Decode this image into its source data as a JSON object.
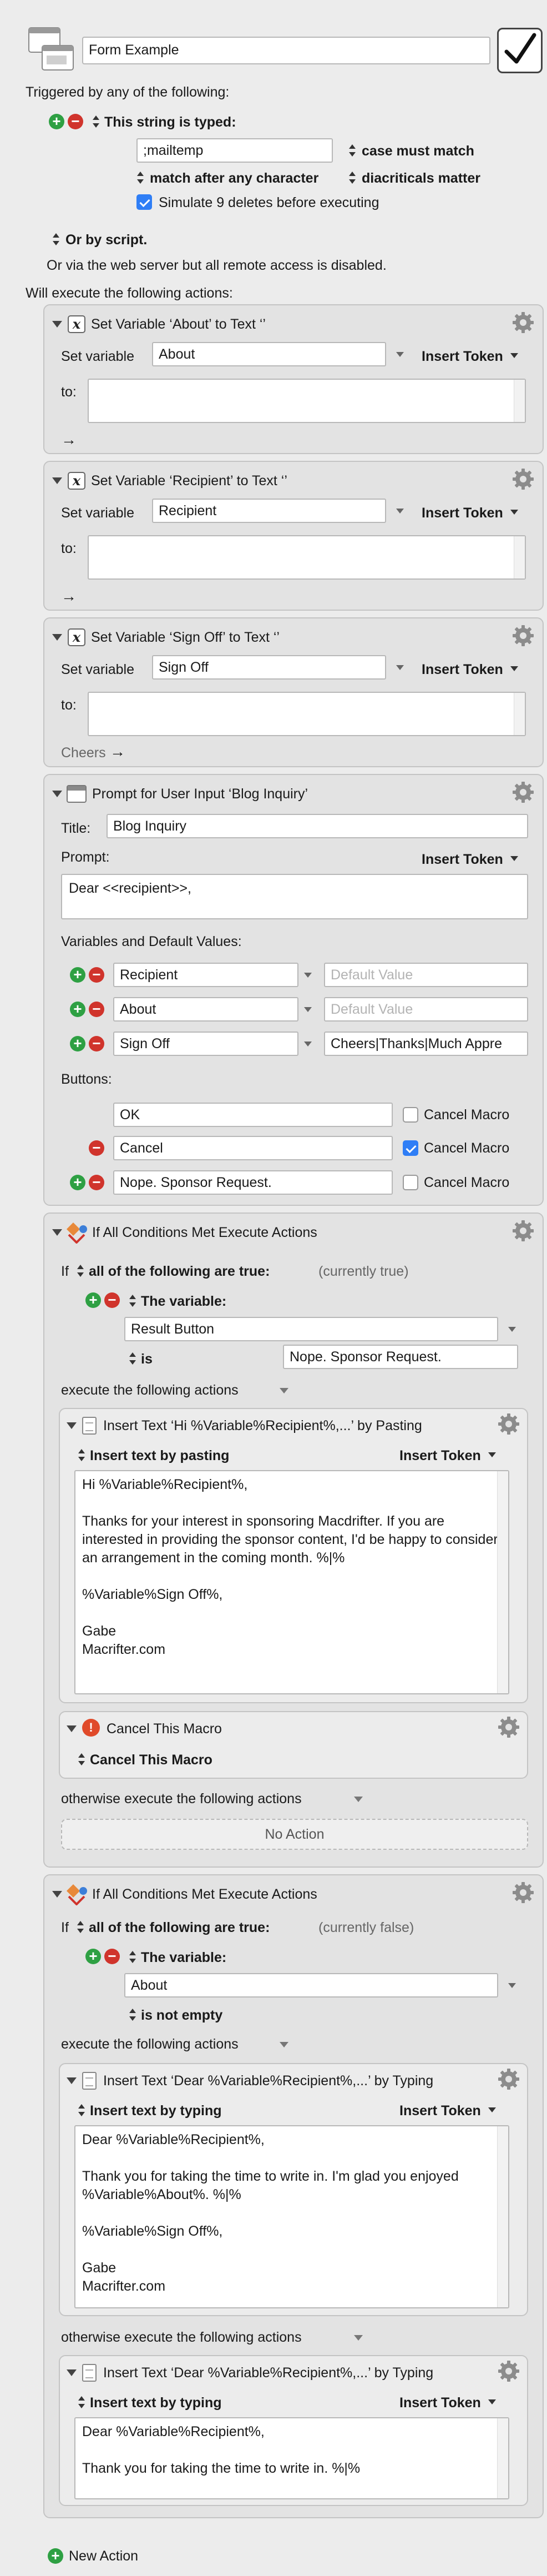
{
  "header": {
    "macro_name": "Form Example"
  },
  "triggers": {
    "triggered_by": "Triggered by any of the following:",
    "string_trigger_label": "This string is typed:",
    "typed_string": ";mailtemp",
    "case_option": "case must match",
    "match_option": "match after any character",
    "diacritic_option": "diacriticals matter",
    "simulate_label": "Simulate 9 deletes before executing",
    "or_script": "Or by script.",
    "web_server": "Or via the web server but all remote access is disabled.",
    "will_execute": "Will execute the following actions:"
  },
  "common": {
    "set_variable": "Set variable",
    "insert_token": "Insert Token",
    "to": "to:",
    "default_value_ph": "Default Value",
    "cancel_macro": "Cancel Macro",
    "execute_following": "execute the following actions",
    "otherwise_execute": "otherwise execute the following actions",
    "the_variable": "The variable:",
    "if_label": "If",
    "all_true": "all of the following are true:"
  },
  "actions": {
    "set_about": {
      "title": "Set Variable ‘About’ to Text ‘’",
      "variable": "About"
    },
    "set_recipient": {
      "title": "Set Variable ‘Recipient’ to Text ‘’",
      "variable": "Recipient"
    },
    "set_signoff": {
      "title": "Set Variable ‘Sign Off’ to Text ‘’",
      "variable": "Sign Off",
      "token_preview": "Cheers"
    },
    "prompt": {
      "title": "Prompt for User Input ‘Blog Inquiry’",
      "title_label": "Title:",
      "title_value": "Blog Inquiry",
      "prompt_label": "Prompt:",
      "prompt_value": "Dear <<recipient>>,",
      "vars_label": "Variables and Default Values:",
      "vars": [
        {
          "name": "Recipient",
          "default": ""
        },
        {
          "name": "About",
          "default": ""
        },
        {
          "name": "Sign Off",
          "default": "Cheers|Thanks|Much Appre"
        }
      ],
      "buttons_label": "Buttons:",
      "buttons": [
        {
          "label": "OK",
          "cancel": false
        },
        {
          "label": "Cancel",
          "cancel": true
        },
        {
          "label": "Nope. Sponsor Request.",
          "cancel": false
        }
      ]
    },
    "if1": {
      "title": "If All Conditions Met Execute Actions",
      "status": "(currently true)",
      "variable": "Result Button",
      "op": "is",
      "value": "Nope. Sponsor Request.",
      "insert1": {
        "title": "Insert Text ‘Hi %Variable%Recipient%,...’ by Pasting",
        "mode": "Insert text by pasting",
        "body": "Hi %Variable%Recipient%,\n\nThanks for your interest in sponsoring Macdrifter. If you are interested in providing the sponsor content, I'd be happy to consider an arrangement in the coming month. %|%\n\n%Variable%Sign Off%,\n\nGabe\nMacrifter.com"
      },
      "cancel_action": {
        "title": "Cancel This Macro",
        "mode": "Cancel This Macro"
      },
      "no_action": "No Action"
    },
    "if2": {
      "title": "If All Conditions Met Execute Actions",
      "status": "(currently false)",
      "variable": "About",
      "op": "is not empty",
      "insert_then": {
        "title": "Insert Text ‘Dear %Variable%Recipient%,...’ by Typing",
        "mode": "Insert text by typing",
        "body": "Dear %Variable%Recipient%,\n\nThank you for taking the time to write in. I'm glad you enjoyed %Variable%About%. %|%\n\n%Variable%Sign Off%,\n\nGabe\nMacrifter.com"
      },
      "insert_else": {
        "title": "Insert Text ‘Dear %Variable%Recipient%,...’ by Typing",
        "mode": "Insert text by typing",
        "body": "Dear %Variable%Recipient%,\n\nThank you for taking the time to write in. %|%\n\n%Variable%Sign Off%,\n\nGabe\nMacrifter.com"
      }
    }
  },
  "footer": {
    "new_action": "New Action"
  }
}
